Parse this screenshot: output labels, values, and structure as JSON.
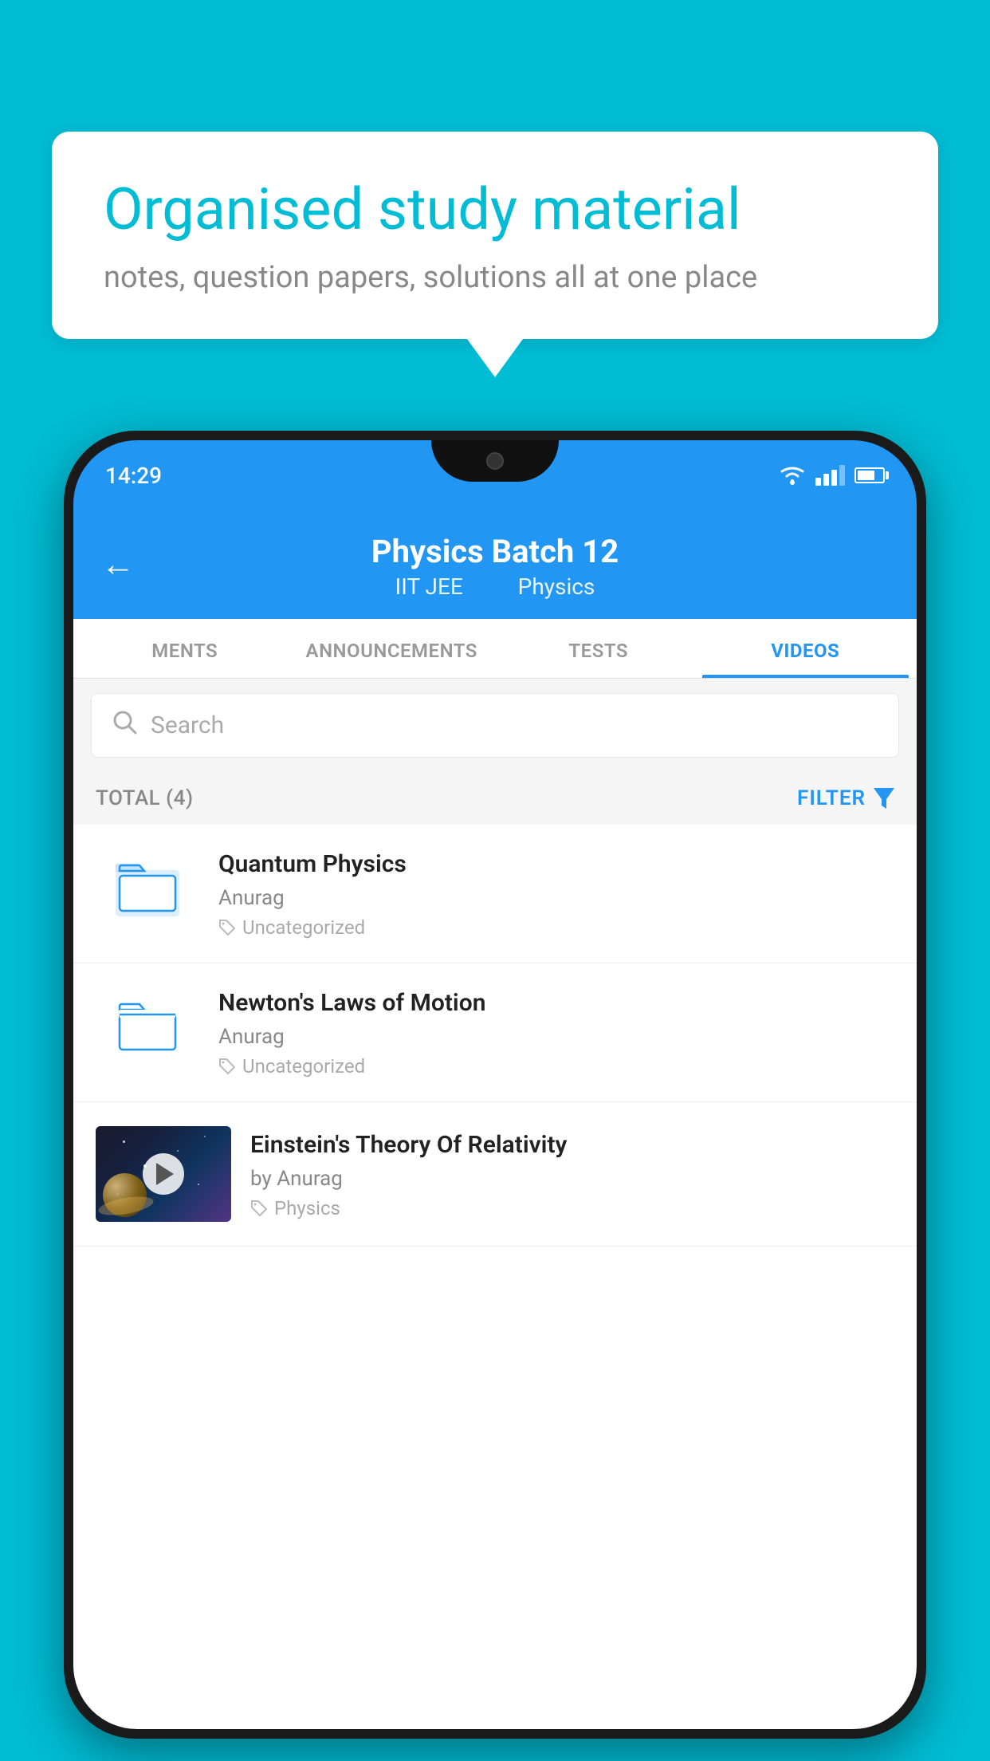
{
  "background_color": "#00bcd4",
  "speech_bubble": {
    "title": "Organised study material",
    "subtitle": "notes, question papers, solutions all at one place"
  },
  "status_bar": {
    "time": "14:29",
    "wifi": true,
    "signal": true,
    "battery": true
  },
  "header": {
    "title": "Physics Batch 12",
    "subtitle_parts": [
      "IIT JEE",
      "Physics"
    ],
    "back_label": "←"
  },
  "tabs": [
    {
      "label": "MENTS",
      "active": false
    },
    {
      "label": "ANNOUNCEMENTS",
      "active": false
    },
    {
      "label": "TESTS",
      "active": false
    },
    {
      "label": "VIDEOS",
      "active": true
    }
  ],
  "search": {
    "placeholder": "Search"
  },
  "filter_bar": {
    "total_label": "TOTAL (4)",
    "filter_label": "FILTER"
  },
  "videos": [
    {
      "id": 1,
      "title": "Quantum Physics",
      "author": "Anurag",
      "tag": "Uncategorized",
      "type": "folder",
      "has_thumbnail": false
    },
    {
      "id": 2,
      "title": "Newton's Laws of Motion",
      "author": "Anurag",
      "tag": "Uncategorized",
      "type": "folder",
      "has_thumbnail": false
    },
    {
      "id": 3,
      "title": "Einstein's Theory Of Relativity",
      "author": "by Anurag",
      "tag": "Physics",
      "type": "video",
      "has_thumbnail": true
    }
  ]
}
